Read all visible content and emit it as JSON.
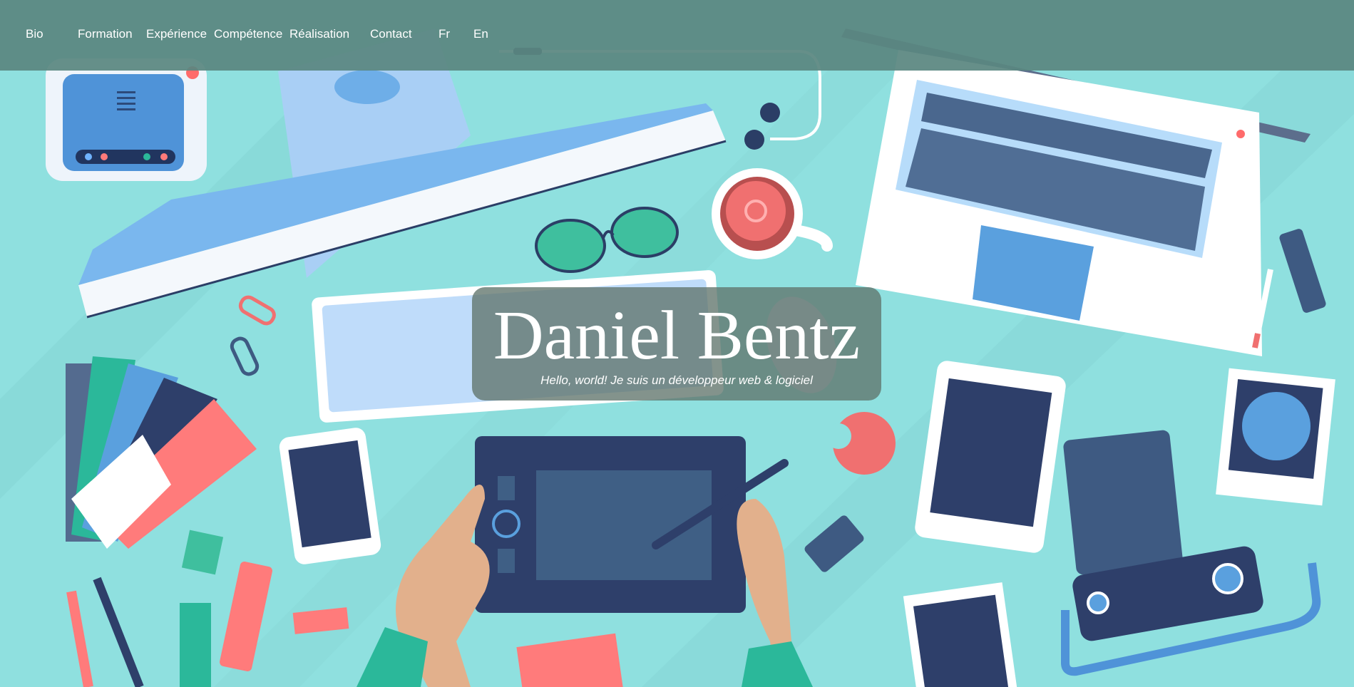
{
  "nav": {
    "items": [
      {
        "label": "Bio"
      },
      {
        "label": "Formation"
      },
      {
        "label": "Expérience"
      },
      {
        "label": "Compétence"
      },
      {
        "label": "Réalisation"
      },
      {
        "label": "Contact"
      },
      {
        "label": "Fr"
      },
      {
        "label": "En"
      }
    ]
  },
  "hero": {
    "title": "Daniel Bentz",
    "subtitle": "Hello, world! Je suis un développeur web & logiciel"
  },
  "colors": {
    "background": "#8fe0df",
    "nav_bar": "#5a8780",
    "hero_box": "#60746c",
    "text": "#ffffff"
  }
}
